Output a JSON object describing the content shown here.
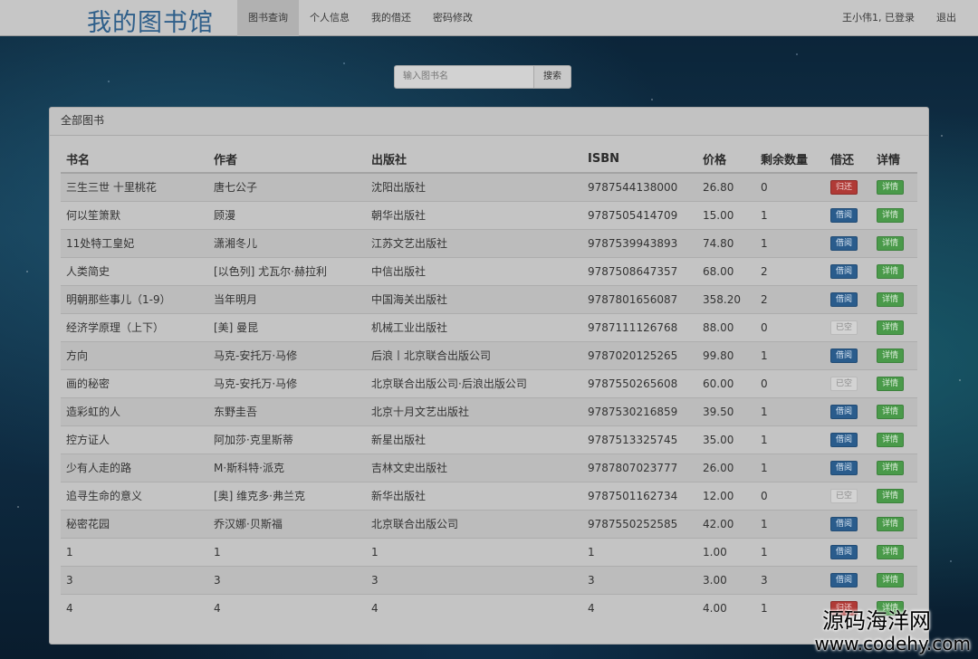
{
  "navbar": {
    "brand": "我的图书馆",
    "links": [
      {
        "label": "图书查询",
        "active": true
      },
      {
        "label": "个人信息",
        "active": false
      },
      {
        "label": "我的借还",
        "active": false
      },
      {
        "label": "密码修改",
        "active": false
      }
    ],
    "user_status": "王小伟1, 已登录",
    "logout": "退出"
  },
  "search": {
    "placeholder": "输入图书名",
    "button": "搜索"
  },
  "panel": {
    "title": "全部图书"
  },
  "table": {
    "headers": [
      "书名",
      "作者",
      "出版社",
      "ISBN",
      "价格",
      "剩余数量",
      "借还",
      "详情"
    ],
    "rows": [
      {
        "title": "三生三世 十里桃花",
        "author": "唐七公子",
        "publisher": "沈阳出版社",
        "isbn": "9787544138000",
        "price": "26.80",
        "remaining": "0",
        "action": "归还",
        "action_type": "return",
        "detail": "详情"
      },
      {
        "title": "何以笙箫默",
        "author": "顾漫",
        "publisher": "朝华出版社",
        "isbn": "9787505414709",
        "price": "15.00",
        "remaining": "1",
        "action": "借阅",
        "action_type": "borrow",
        "detail": "详情"
      },
      {
        "title": "11处特工皇妃",
        "author": "潇湘冬儿",
        "publisher": "江苏文艺出版社",
        "isbn": "9787539943893",
        "price": "74.80",
        "remaining": "1",
        "action": "借阅",
        "action_type": "borrow",
        "detail": "详情"
      },
      {
        "title": "人类简史",
        "author": "[以色列] 尤瓦尔·赫拉利",
        "publisher": "中信出版社",
        "isbn": "9787508647357",
        "price": "68.00",
        "remaining": "2",
        "action": "借阅",
        "action_type": "borrow",
        "detail": "详情"
      },
      {
        "title": "明朝那些事儿（1-9）",
        "author": "当年明月",
        "publisher": "中国海关出版社",
        "isbn": "9787801656087",
        "price": "358.20",
        "remaining": "2",
        "action": "借阅",
        "action_type": "borrow",
        "detail": "详情"
      },
      {
        "title": "经济学原理（上下）",
        "author": "[美] 曼昆",
        "publisher": "机械工业出版社",
        "isbn": "9787111126768",
        "price": "88.00",
        "remaining": "0",
        "action": "已空",
        "action_type": "none",
        "detail": "详情"
      },
      {
        "title": "方向",
        "author": "马克-安托万·马修",
        "publisher": "后浪丨北京联合出版公司",
        "isbn": "9787020125265",
        "price": "99.80",
        "remaining": "1",
        "action": "借阅",
        "action_type": "borrow",
        "detail": "详情"
      },
      {
        "title": "画的秘密",
        "author": "马克-安托万·马修",
        "publisher": "北京联合出版公司·后浪出版公司",
        "isbn": "9787550265608",
        "price": "60.00",
        "remaining": "0",
        "action": "已空",
        "action_type": "none",
        "detail": "详情"
      },
      {
        "title": "造彩虹的人",
        "author": "东野圭吾",
        "publisher": "北京十月文艺出版社",
        "isbn": "9787530216859",
        "price": "39.50",
        "remaining": "1",
        "action": "借阅",
        "action_type": "borrow",
        "detail": "详情"
      },
      {
        "title": "控方证人",
        "author": "阿加莎·克里斯蒂",
        "publisher": "新星出版社",
        "isbn": "9787513325745",
        "price": "35.00",
        "remaining": "1",
        "action": "借阅",
        "action_type": "borrow",
        "detail": "详情"
      },
      {
        "title": "少有人走的路",
        "author": "M·斯科特·派克",
        "publisher": "吉林文史出版社",
        "isbn": "9787807023777",
        "price": "26.00",
        "remaining": "1",
        "action": "借阅",
        "action_type": "borrow",
        "detail": "详情"
      },
      {
        "title": "追寻生命的意义",
        "author": "[奥] 维克多·弗兰克",
        "publisher": "新华出版社",
        "isbn": "9787501162734",
        "price": "12.00",
        "remaining": "0",
        "action": "已空",
        "action_type": "none",
        "detail": "详情"
      },
      {
        "title": "秘密花园",
        "author": "乔汉娜·贝斯福",
        "publisher": "北京联合出版公司",
        "isbn": "9787550252585",
        "price": "42.00",
        "remaining": "1",
        "action": "借阅",
        "action_type": "borrow",
        "detail": "详情"
      },
      {
        "title": "1",
        "author": "1",
        "publisher": "1",
        "isbn": "1",
        "price": "1.00",
        "remaining": "1",
        "action": "借阅",
        "action_type": "borrow",
        "detail": "详情"
      },
      {
        "title": "3",
        "author": "3",
        "publisher": "3",
        "isbn": "3",
        "price": "3.00",
        "remaining": "3",
        "action": "借阅",
        "action_type": "borrow",
        "detail": "详情"
      },
      {
        "title": "4",
        "author": "4",
        "publisher": "4",
        "isbn": "4",
        "price": "4.00",
        "remaining": "1",
        "action": "归还",
        "action_type": "return",
        "detail": "详情"
      }
    ]
  },
  "watermark": {
    "name": "源码海洋网",
    "url": "www.codehy.com"
  }
}
